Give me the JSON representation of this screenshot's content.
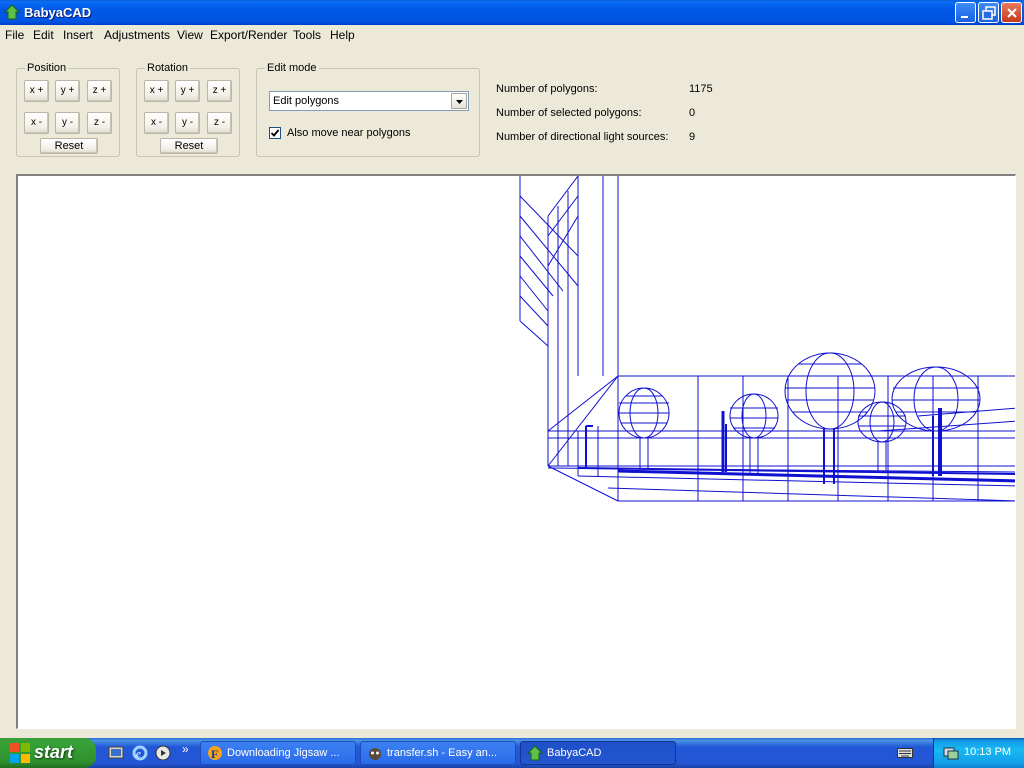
{
  "window": {
    "title": "BabyaCAD"
  },
  "menu": [
    "File",
    "Edit",
    "Insert",
    "Adjustments",
    "View",
    "Export/Render",
    "Tools",
    "Help"
  ],
  "position": {
    "label": "Position",
    "buttons": [
      "x +",
      "y +",
      "z +",
      "x -",
      "y -",
      "z -"
    ],
    "reset": "Reset"
  },
  "rotation": {
    "label": "Rotation",
    "buttons": [
      "x +",
      "y +",
      "z +",
      "x -",
      "y -",
      "z -"
    ],
    "reset": "Reset"
  },
  "edit_mode": {
    "label": "Edit mode",
    "selected": "Edit polygons",
    "checkbox_label": "Also move near polygons",
    "checkbox_checked": true
  },
  "stats": [
    {
      "label": "Number of polygons:",
      "value": "1175"
    },
    {
      "label": "Number of selected polygons:",
      "value": "0"
    },
    {
      "label": "Number of directional light sources:",
      "value": "9"
    }
  ],
  "taskbar": {
    "start_label": "start",
    "overflow": "»",
    "tasks": [
      {
        "label": "Downloading Jigsaw ...",
        "icon": "firefox-icon",
        "active": false
      },
      {
        "label": "transfer.sh - Easy an...",
        "icon": "transfer-icon",
        "active": false
      },
      {
        "label": "BabyaCAD",
        "icon": "babyacad-icon",
        "active": true
      }
    ],
    "clock": "10:13 PM"
  },
  "colors": {
    "wireframe": "#0000ff",
    "titlebar": "#0054e3",
    "taskbar": "#245edb"
  }
}
